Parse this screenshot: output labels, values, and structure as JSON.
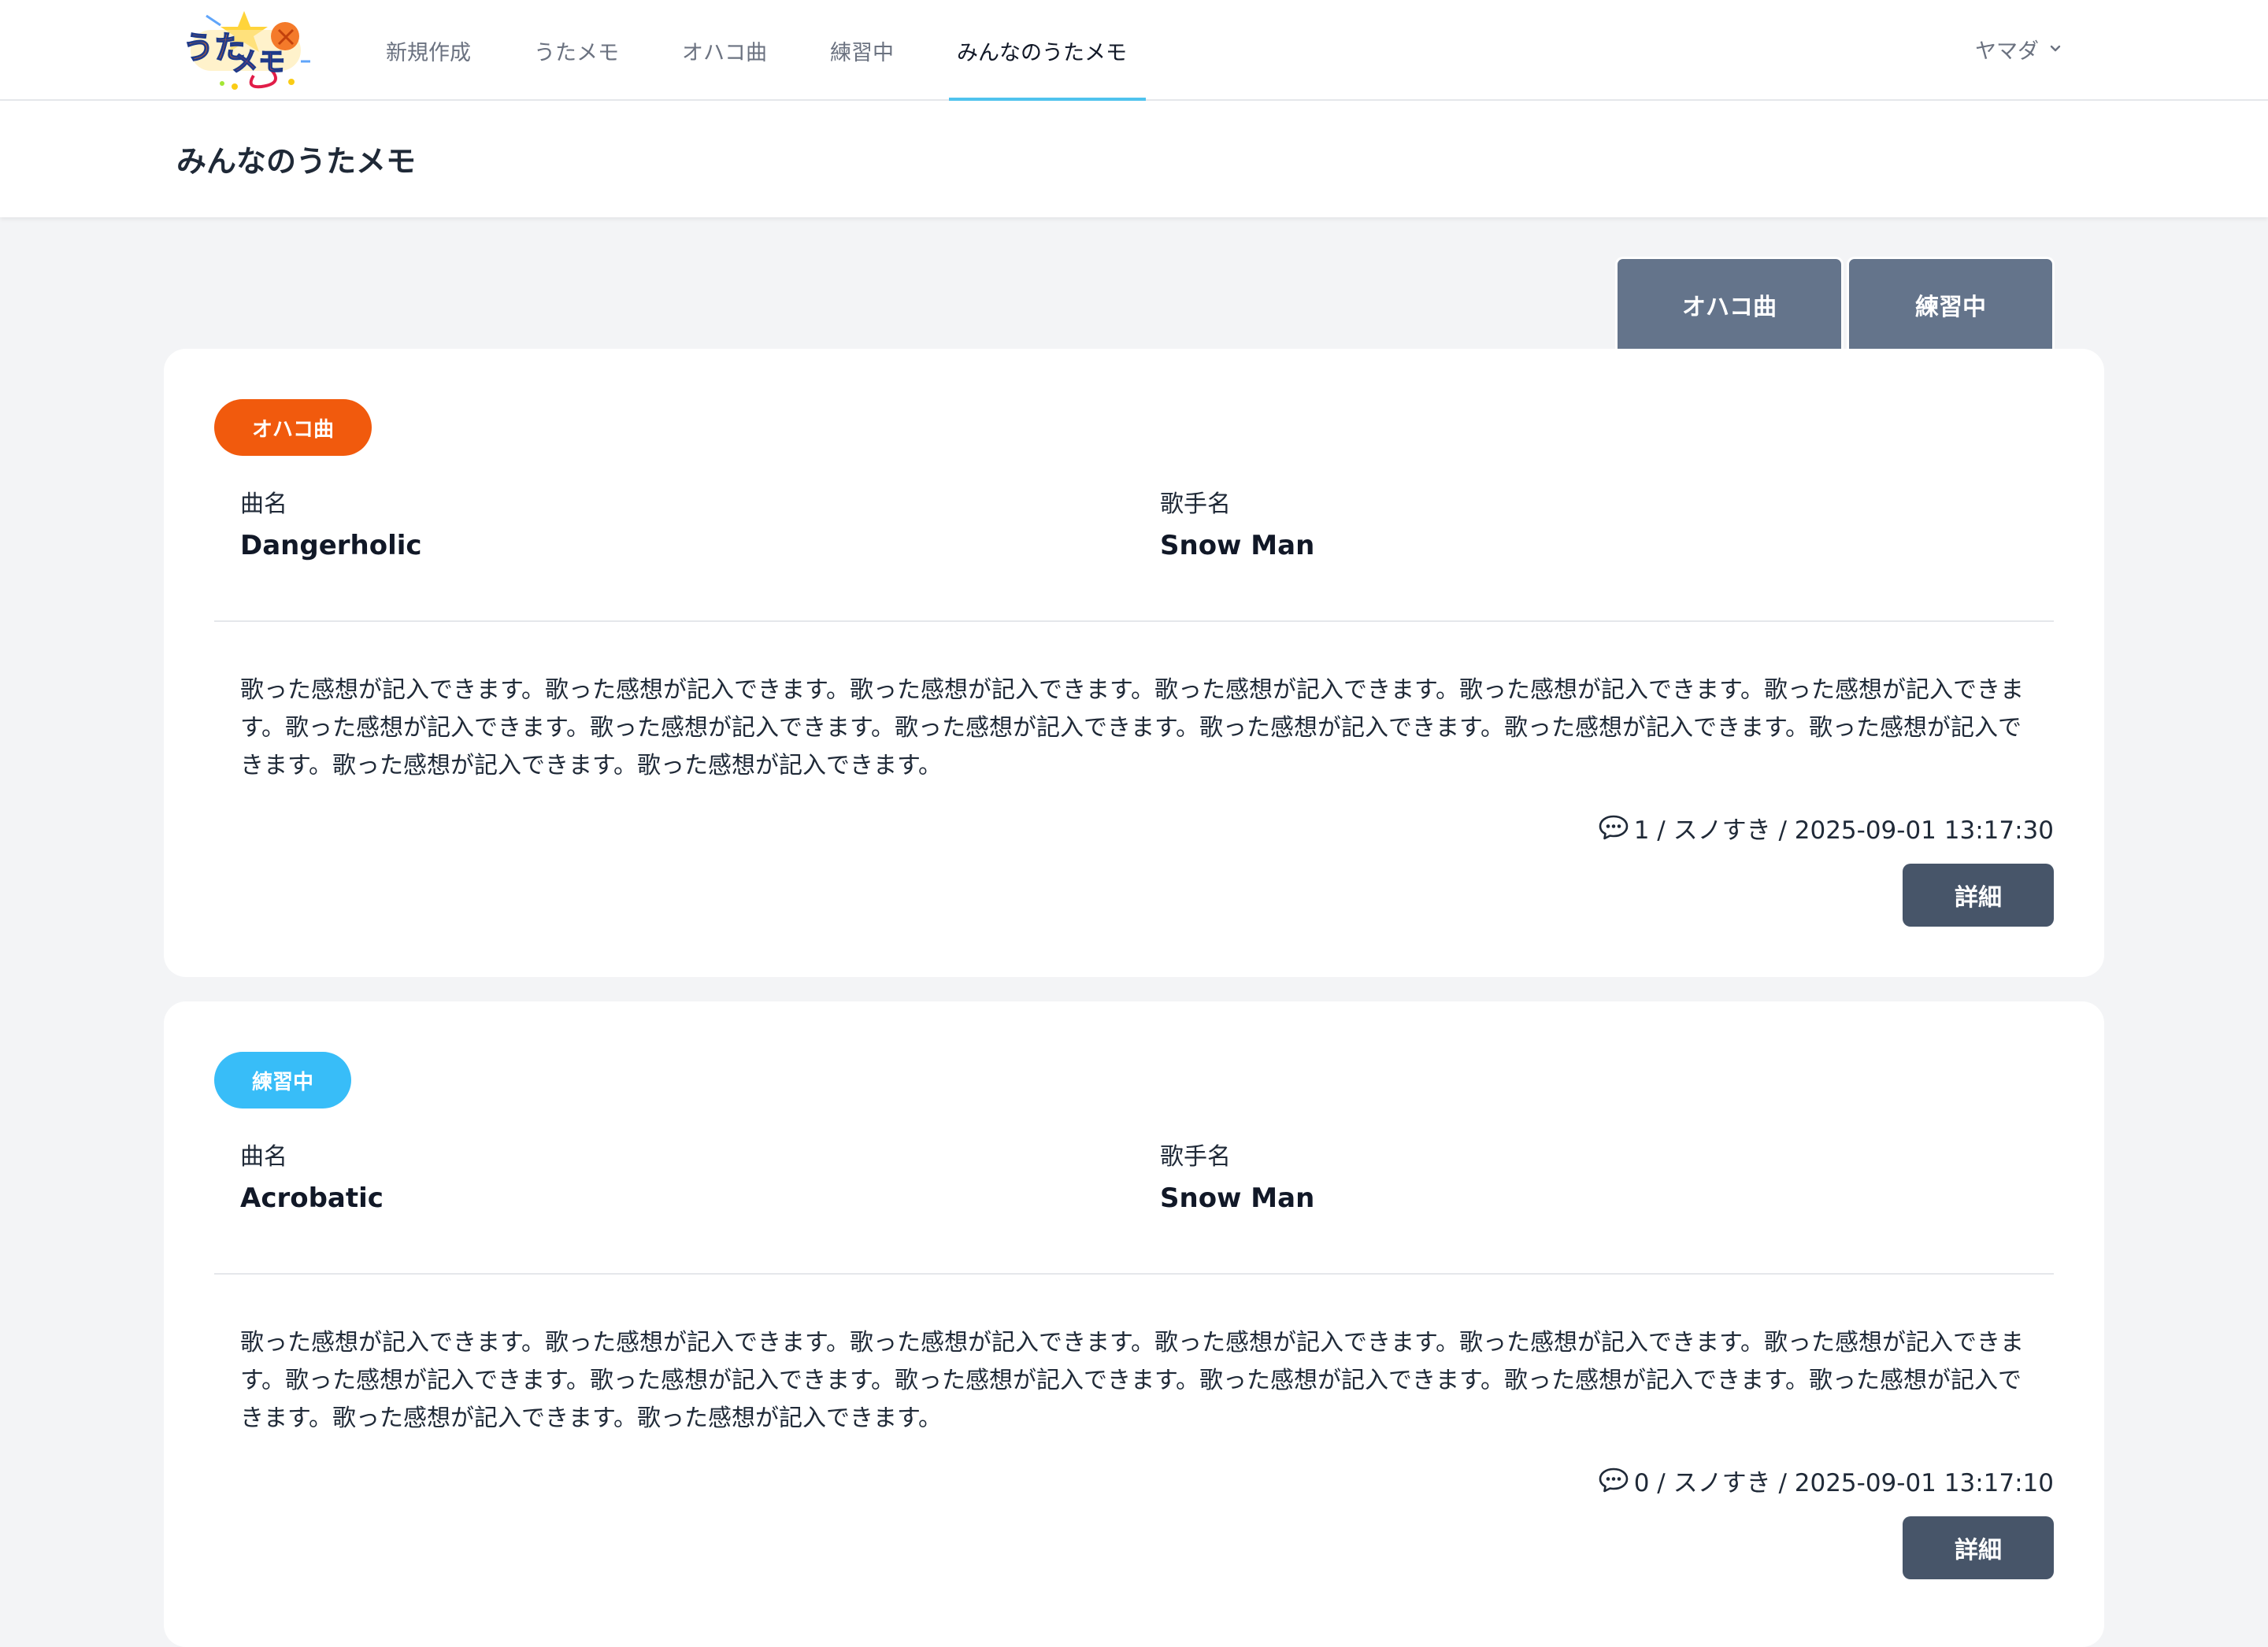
{
  "nav": {
    "links": [
      "新規作成",
      "うたメモ",
      "オハコ曲",
      "練習中",
      "みんなのうたメモ"
    ],
    "active_index": 4,
    "user_name": "ヤマダ",
    "user_menu_icon": "chevron-down-icon"
  },
  "page": {
    "title": "みんなのうたメモ"
  },
  "filters": {
    "tabs": [
      "オハコ曲",
      "練習中"
    ]
  },
  "colors": {
    "accent_underline": "#4fc3ee",
    "badge_ohako": "#f15a0d",
    "badge_practice": "#38bdf8",
    "button": "#475569",
    "filter_tab": "#64748b"
  },
  "labels": {
    "song": "曲名",
    "artist": "歌手名",
    "detail_button": "詳細"
  },
  "posts": [
    {
      "badge": "オハコ曲",
      "song": "Dangerholic",
      "artist": "Snow Man",
      "text": "歌った感想が記入できます。歌った感想が記入できます。歌った感想が記入できます。歌った感想が記入できます。歌った感想が記入できます。歌った感想が記入できます。歌った感想が記入できます。歌った感想が記入できます。歌った感想が記入できます。歌った感想が記入できます。歌った感想が記入できます。歌った感想が記入できます。歌った感想が記入できます。歌った感想が記入できます。",
      "meta": "1 / スノすき / 2025-09-01 13:17:30"
    },
    {
      "badge": "練習中",
      "song": "Acrobatic",
      "artist": "Snow Man",
      "text": "歌った感想が記入できます。歌った感想が記入できます。歌った感想が記入できます。歌った感想が記入できます。歌った感想が記入できます。歌った感想が記入できます。歌った感想が記入できます。歌った感想が記入できます。歌った感想が記入できます。歌った感想が記入できます。歌った感想が記入できます。歌った感想が記入できます。歌った感想が記入できます。歌った感想が記入できます。",
      "meta": "0 / スノすき / 2025-09-01 13:17:10"
    }
  ]
}
